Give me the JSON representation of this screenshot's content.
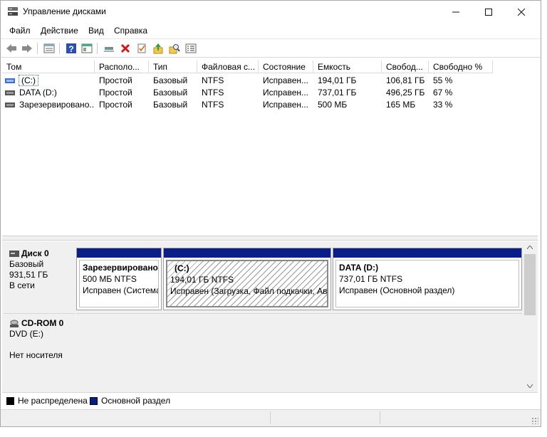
{
  "window": {
    "title": "Управление дисками"
  },
  "menu": [
    "Файл",
    "Действие",
    "Вид",
    "Справка"
  ],
  "toolbar": {
    "icons": [
      "back-icon",
      "forward-icon",
      "list-view-icon",
      "help-icon",
      "panel-icon",
      "connect-icon",
      "delete-icon",
      "check-icon",
      "import-icon",
      "search-icon",
      "properties-icon"
    ]
  },
  "volume_list": {
    "columns": [
      "Том",
      "Располо...",
      "Тип",
      "Файловая с...",
      "Состояние",
      "Емкость",
      "Свобод...",
      "Свободно %"
    ],
    "rows": [
      {
        "name": "(C:)",
        "layout": "Простой",
        "type": "Базовый",
        "fs": "NTFS",
        "status": "Исправен...",
        "capacity": "194,01 ГБ",
        "free": "106,81 ГБ",
        "free_pct": "55 %"
      },
      {
        "name": "DATA (D:)",
        "layout": "Простой",
        "type": "Базовый",
        "fs": "NTFS",
        "status": "Исправен...",
        "capacity": "737,01 ГБ",
        "free": "496,25 ГБ",
        "free_pct": "67 %"
      },
      {
        "name": "Зарезервировано...",
        "layout": "Простой",
        "type": "Базовый",
        "fs": "NTFS",
        "status": "Исправен...",
        "capacity": "500 МБ",
        "free": "165 МБ",
        "free_pct": "33 %"
      }
    ]
  },
  "disks": [
    {
      "name": "Диск 0",
      "type": "Базовый",
      "size": "931,51 ГБ",
      "state": "В сети",
      "partitions": [
        {
          "name": "Зарезервировано",
          "size_fs": "500 МБ NTFS",
          "status": "Исправен (Система"
        },
        {
          "name": "(C:)",
          "size_fs": "194,01 ГБ NTFS",
          "status": "Исправен (Загрузка, Файл подкачки, Ава"
        },
        {
          "name": "DATA  (D:)",
          "size_fs": "737,01 ГБ NTFS",
          "status": "Исправен (Основной раздел)"
        }
      ]
    },
    {
      "name": "CD-ROM 0",
      "type": "DVD (E:)",
      "blank": "",
      "state": "Нет носителя"
    }
  ],
  "legend": [
    {
      "label": "Не распределена",
      "color": "#000000"
    },
    {
      "label": "Основной раздел",
      "color": "#0a1e8a"
    }
  ]
}
